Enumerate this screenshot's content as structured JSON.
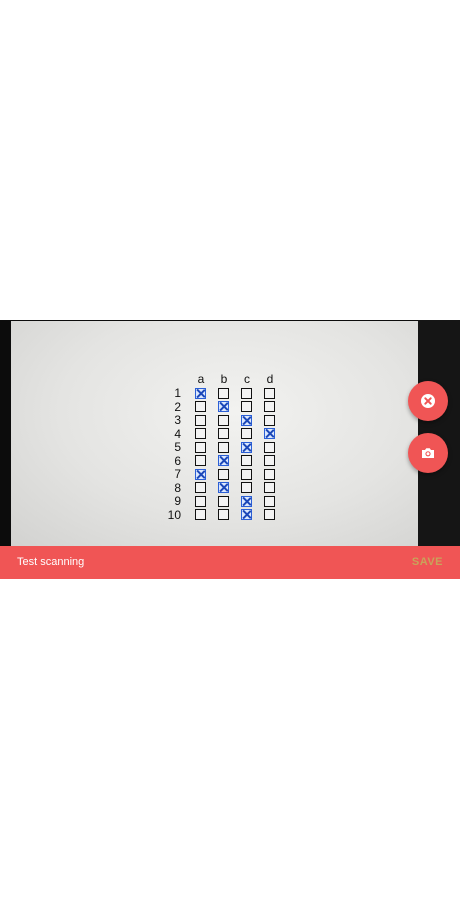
{
  "toolbar": {
    "title": "Test scanning",
    "save_label": "SAVE"
  },
  "answer_sheet": {
    "columns": [
      "a",
      "b",
      "c",
      "d"
    ],
    "rows": [
      {
        "number": "1",
        "marked": "a"
      },
      {
        "number": "2",
        "marked": "b"
      },
      {
        "number": "3",
        "marked": "c"
      },
      {
        "number": "4",
        "marked": "d"
      },
      {
        "number": "5",
        "marked": "c"
      },
      {
        "number": "6",
        "marked": "b"
      },
      {
        "number": "7",
        "marked": "a"
      },
      {
        "number": "8",
        "marked": "b"
      },
      {
        "number": "9",
        "marked": "c"
      },
      {
        "number": "10",
        "marked": "c"
      }
    ]
  },
  "actions": {
    "cancel_icon": "close-circle-icon",
    "capture_icon": "camera-icon"
  },
  "colors": {
    "accent": "#f05555",
    "save_text": "#c9a35a",
    "mark": "#2b5fd6"
  }
}
